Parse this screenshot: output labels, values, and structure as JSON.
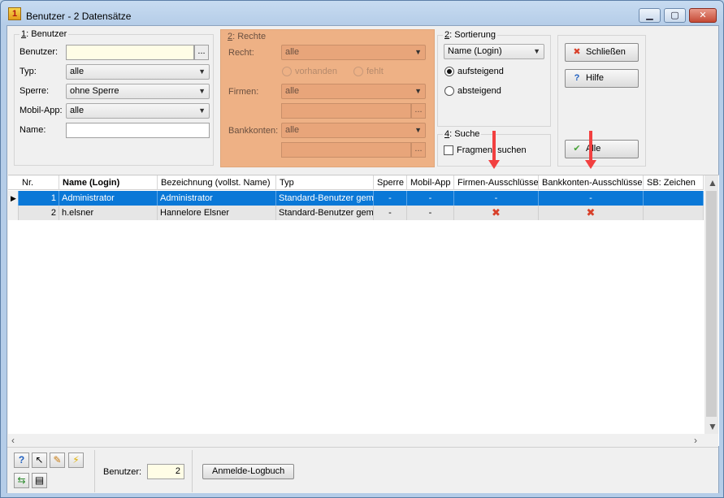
{
  "window": {
    "title": "Benutzer - 2 Datensätze",
    "min": "▁",
    "max": "▢",
    "close": "✕"
  },
  "benutzer_group": {
    "title_key": "1",
    "title_rest": ": Benutzer",
    "benutzer_label": "Benutzer:",
    "benutzer_value": "",
    "typ_label": "Typ:",
    "typ_value": "alle",
    "sperre_label": "Sperre:",
    "sperre_value": "ohne Sperre",
    "mobil_label": "Mobil-App:",
    "mobil_value": "alle",
    "name_label": "Name:",
    "name_value": "",
    "ellipsis": "..."
  },
  "rechte_group": {
    "title_key": "2",
    "title_rest": ": Rechte",
    "recht_label": "Recht:",
    "recht_value": "alle",
    "vorhanden": "vorhanden",
    "fehlt": "fehlt",
    "firmen_label": "Firmen:",
    "firmen_value": "alle",
    "bankkonten_label": "Bankkonten:",
    "bankkonten_value": "alle",
    "ellipsis": "..."
  },
  "sortierung_group": {
    "title_key": "2",
    "title_rest": ": Sortierung",
    "sort_value": "Name (Login)",
    "aufsteigend": "aufsteigend",
    "absteigend": "absteigend"
  },
  "suche_group": {
    "title_key": "4",
    "title_rest": ": Suche",
    "fragment_label": "Fragment suchen"
  },
  "buttons": {
    "schliessen": "Schließen",
    "hilfe": "Hilfe",
    "alle": "Alle"
  },
  "grid": {
    "columns": [
      "Nr.",
      "Name (Login)",
      "Bezeichnung (vollst. Name)",
      "Typ",
      "Sperre",
      "Mobil-App",
      "Firmen-Ausschlüsse",
      "Bankkonten-Ausschlüsse",
      "SB: Zeichen"
    ],
    "rows": [
      {
        "nr": "1",
        "name": "Administrator",
        "bez": "Administrator",
        "typ": "Standard-Benutzer gemä",
        "sperre": "-",
        "mobil": "-",
        "firmen": "-",
        "bank": "-",
        "sb": ""
      },
      {
        "nr": "2",
        "name": "h.elsner",
        "bez": "Hannelore Elsner",
        "typ": "Standard-Benutzer gemä",
        "sperre": "-",
        "mobil": "-",
        "firmen": "✖",
        "bank": "✖",
        "sb": ""
      }
    ]
  },
  "footer": {
    "benutzer_label": "Benutzer:",
    "benutzer_count": "2",
    "logbuch_button": "Anmelde-Logbuch"
  },
  "colors": {
    "accent_orange": "#eeb185",
    "selection": "#0a78d7",
    "arrow": "#f24040"
  }
}
